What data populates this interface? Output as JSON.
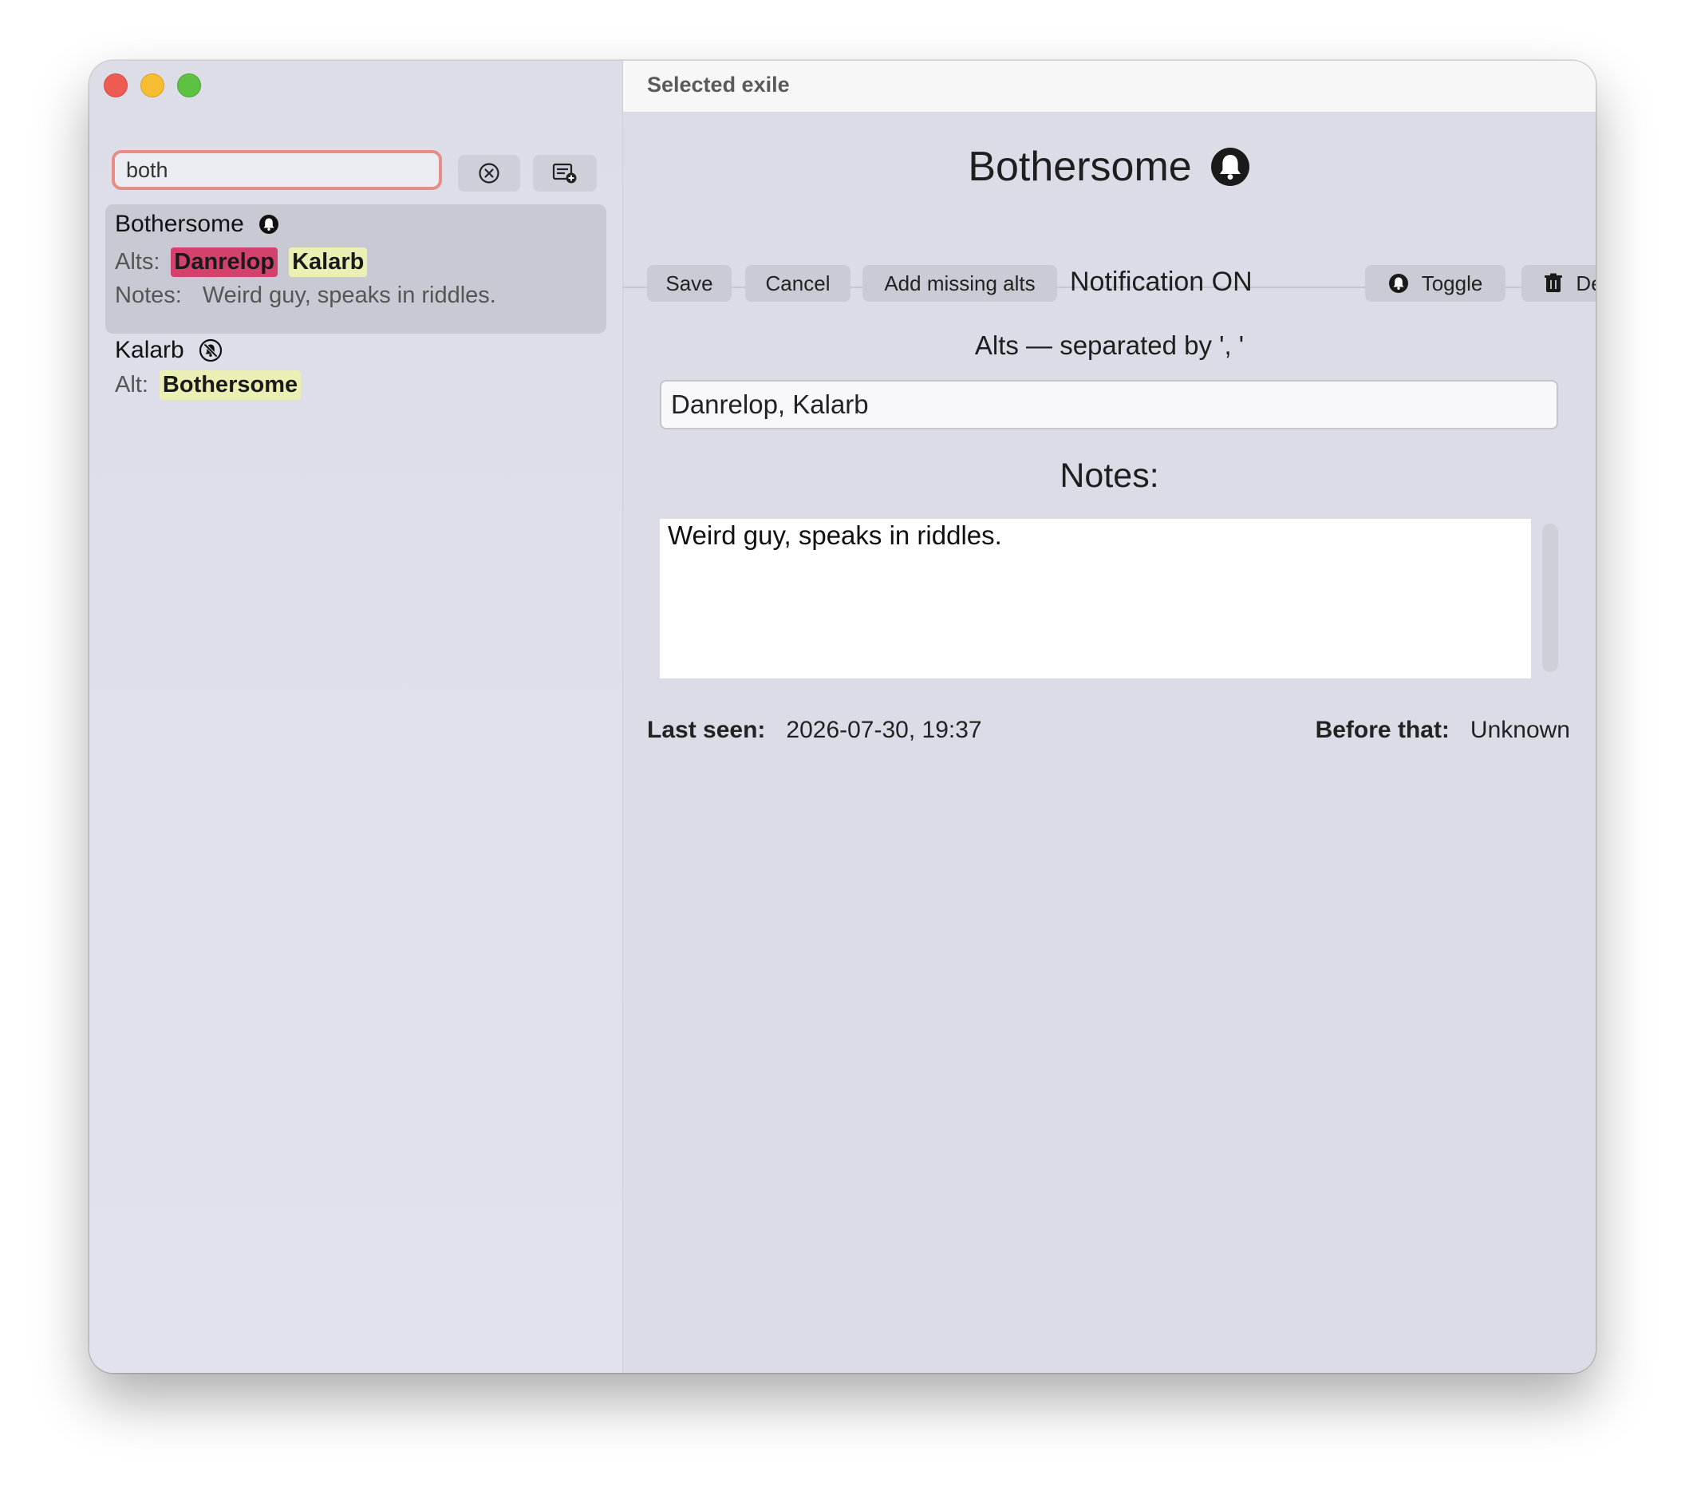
{
  "window": {
    "title": "Selected exile"
  },
  "sidebar": {
    "search": {
      "value": "both",
      "placeholder": ""
    },
    "clear_icon": "clear-circle-icon",
    "add_icon": "add-list-icon",
    "items": [
      {
        "name": "Bothersome",
        "notification": "on",
        "alts_label": "Alts:",
        "alts": [
          "Danrelop",
          "Kalarb"
        ],
        "notes_label": "Notes:",
        "notes": "Weird guy, speaks in riddles."
      },
      {
        "name": "Kalarb",
        "notification": "off",
        "alts_label": "Alt:",
        "alts": [
          "Bothersome"
        ]
      }
    ]
  },
  "detail": {
    "name": "Bothersome",
    "buttons": {
      "save": "Save",
      "cancel": "Cancel",
      "add_missing_alts": "Add missing alts",
      "toggle": "Toggle",
      "delete": "Delete"
    },
    "notification_status": "Notification ON",
    "alts_label": "Alts — separated by ', '",
    "alts_value": "Danrelop, Kalarb",
    "notes_label": "Notes:",
    "notes_value": "Weird guy, speaks in riddles.",
    "last_seen_label": "Last seen:",
    "last_seen_value": "2026-07-30, 19:37",
    "before_label": "Before that:",
    "before_value": "Unknown"
  },
  "colors": {
    "highlight_pink": "#d2426d",
    "highlight_yellow": "#ecefb4",
    "search_focus_ring": "#e58d86"
  }
}
